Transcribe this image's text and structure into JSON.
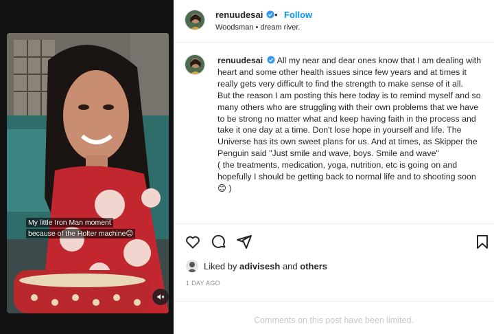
{
  "post": {
    "username": "renuudesai",
    "dot": "•",
    "follow_label": "Follow",
    "location": "Woodsman • dream river.",
    "caption_paragraphs": [
      "All my near and dear ones know that I am dealing with heart and some other health issues since few years and at times it really gets very difficult to find the strength to make sense of it all.",
      "But the reason I am posting this here today is to remind myself and so many others who are struggling with their own problems that we have to be strong no matter what and keep having faith in the process and take it one day at a time. Don't lose hope in yourself and life. The Universe has its own sweet plans for us. And at times, as Skipper the Penguin said \"Just smile and wave, boys. Smile and wave\"",
      "( the treatments, medication, yoga, nutrition, etc is going on and hopefully I should be getting back to normal life and to shooting soon😊 )"
    ],
    "media_overlay_text": "My little Iron Man moment because of the Holter machine😊",
    "liked_by_prefix": "Liked by",
    "liked_by_user": "adivisesh",
    "liked_by_and": "and",
    "liked_by_others": "others",
    "timestamp": "1 DAY AGO",
    "comments_limited": "Comments on this post have been limited."
  },
  "icons": {
    "like": "heart-icon",
    "comment": "comment-icon",
    "share": "send-icon",
    "save": "bookmark-icon",
    "mute": "speaker-muted-icon",
    "verified": "verified-badge-icon"
  },
  "colors": {
    "accent": "#0095f6",
    "verified": "#3897f0",
    "muted_text": "#8e8e8e",
    "limited_text": "#c7c7c7"
  }
}
